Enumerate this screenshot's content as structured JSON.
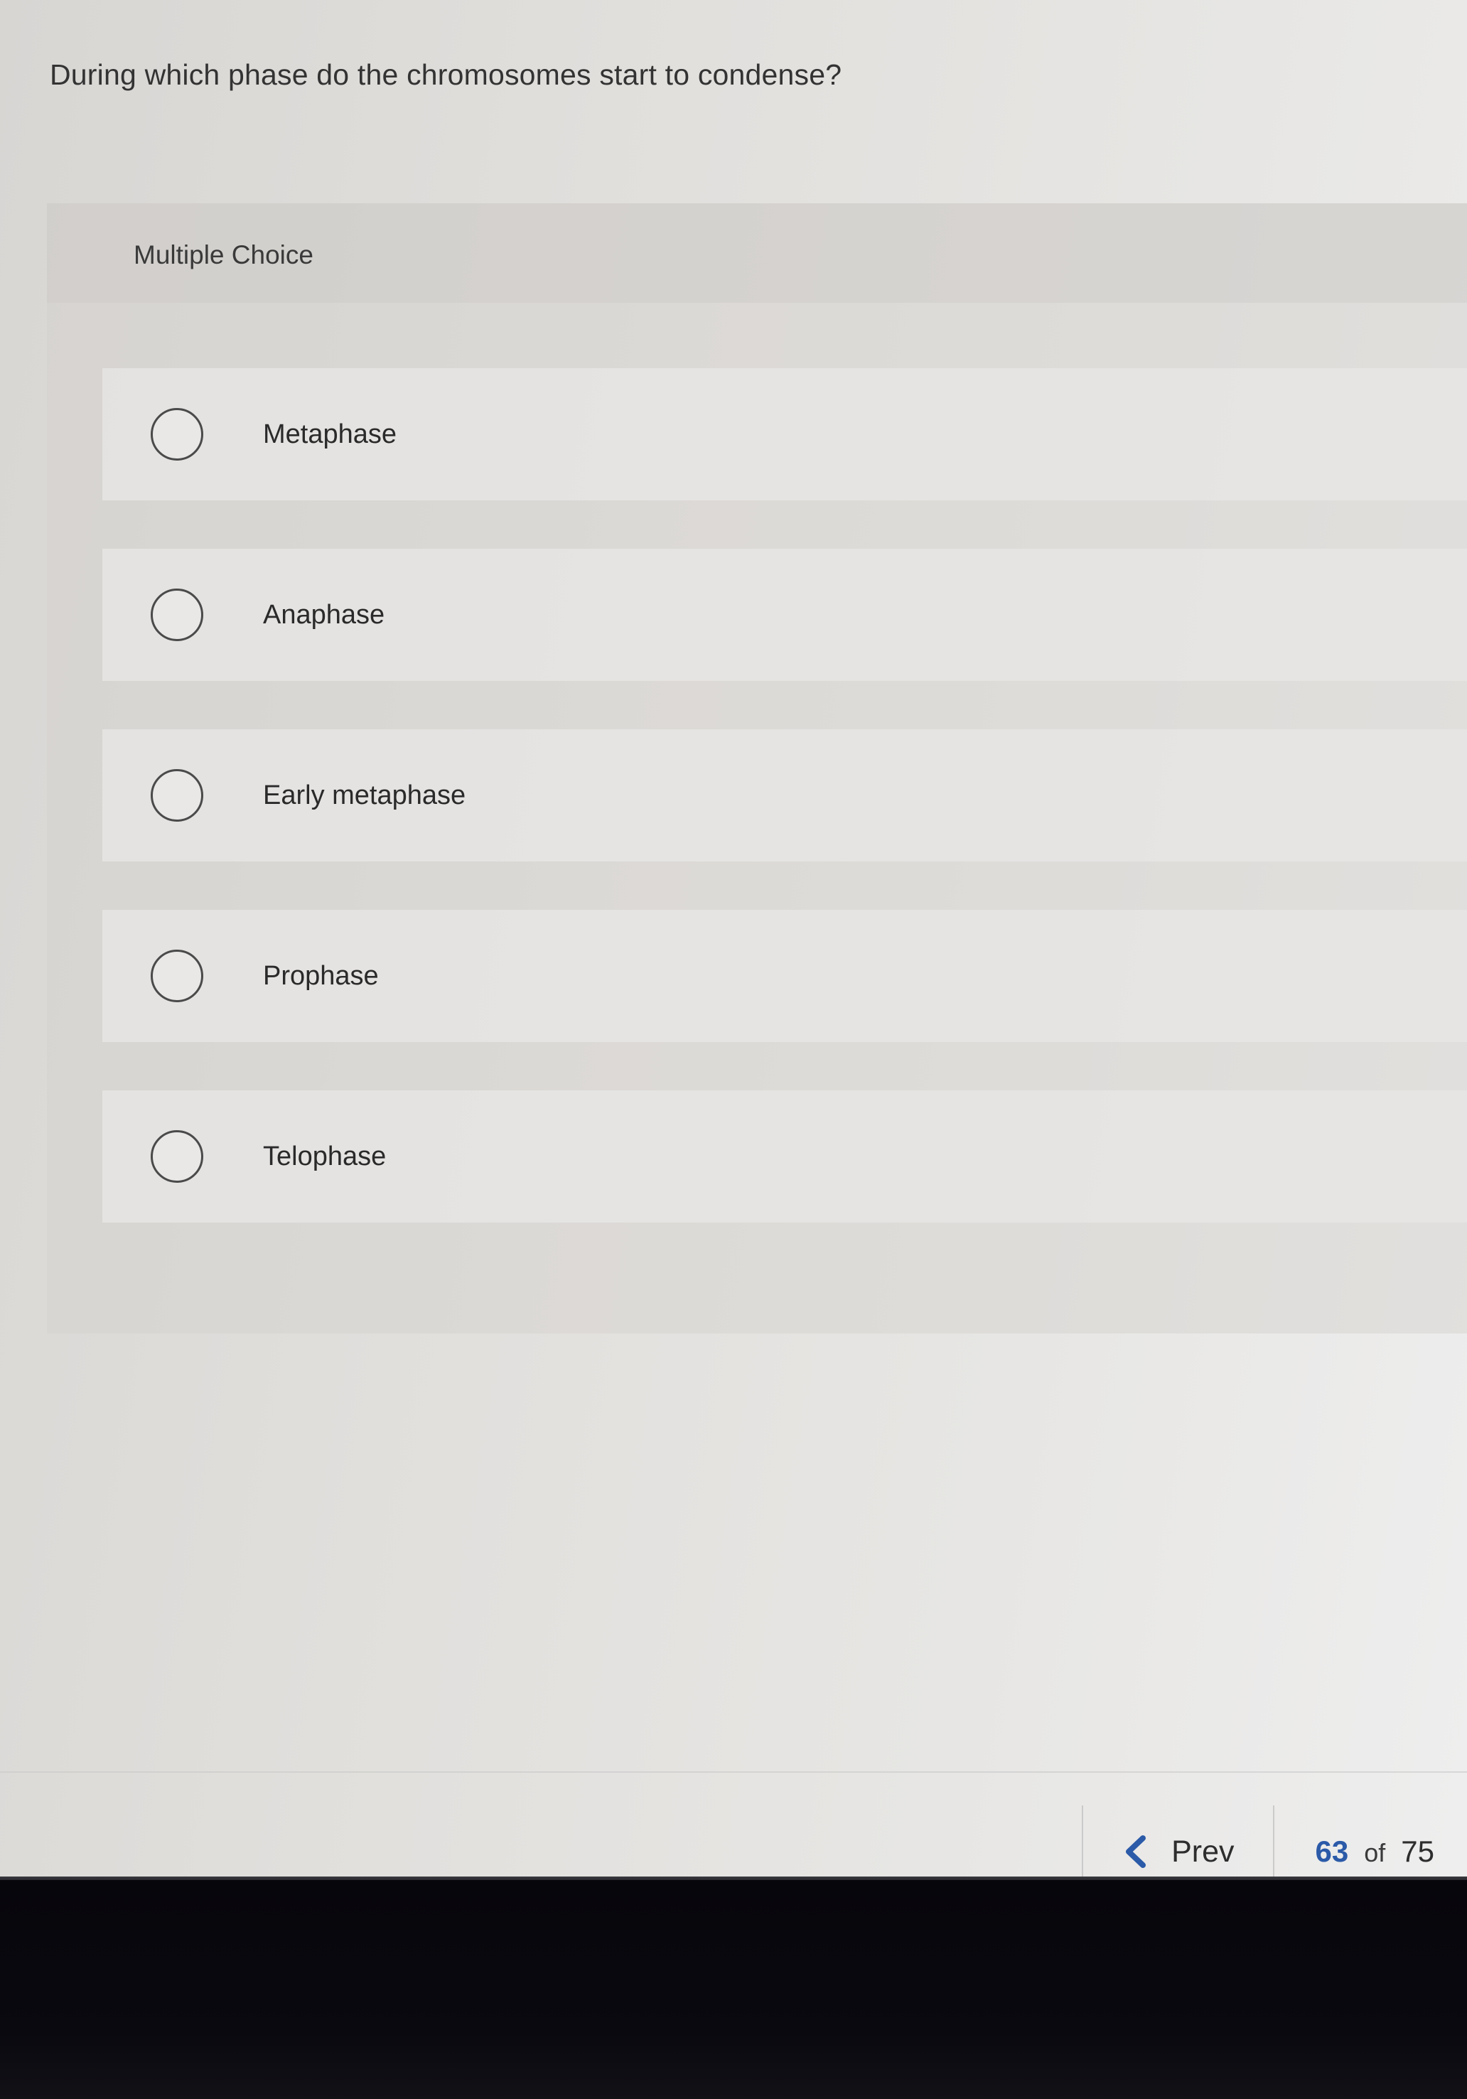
{
  "question": {
    "text": "During which phase do the chromosomes start to condense?"
  },
  "panel": {
    "label": "Multiple Choice"
  },
  "options": [
    {
      "label": "Metaphase",
      "selected": false
    },
    {
      "label": "Anaphase",
      "selected": false
    },
    {
      "label": "Early metaphase",
      "selected": false
    },
    {
      "label": "Prophase",
      "selected": false
    },
    {
      "label": "Telophase",
      "selected": false
    }
  ],
  "navigation": {
    "prev_label": "Prev",
    "prev_icon": "chevron-left-icon",
    "current_page": "63",
    "of_label": "of",
    "total_pages": "75"
  },
  "colors": {
    "accent": "#2b5aa8"
  }
}
